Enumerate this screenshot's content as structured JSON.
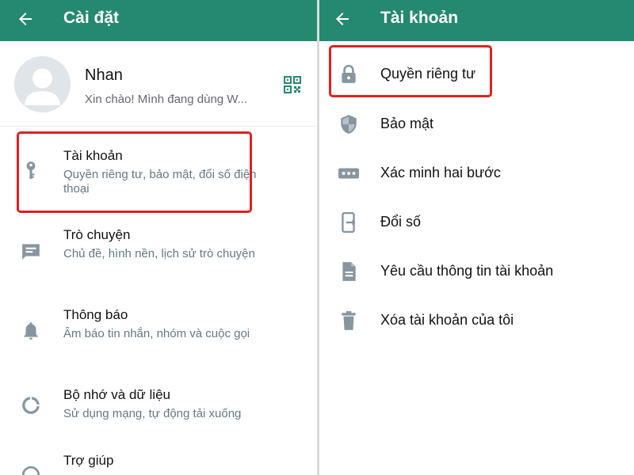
{
  "left": {
    "header_title": "Cài đặt",
    "profile": {
      "name": "Nhan",
      "status": "Xin chào! Mình đang dùng W..."
    },
    "items": [
      {
        "title": "Tài khoản",
        "subtitle": "Quyền riêng tư, bảo mật, đổi số điện thoại",
        "icon": "key-icon"
      },
      {
        "title": "Trò chuyện",
        "subtitle": "Chủ đề, hình nền, lịch sử trò chuyện",
        "icon": "chat-icon"
      },
      {
        "title": "Thông báo",
        "subtitle": "Âm báo tin nhắn, nhóm và cuộc gọi",
        "icon": "bell-icon"
      },
      {
        "title": "Bộ nhớ và dữ liệu",
        "subtitle": "Sử dụng mạng, tự động tải xuống",
        "icon": "data-usage-icon"
      },
      {
        "title": "Trợ giúp",
        "subtitle": "",
        "icon": "help-icon"
      }
    ]
  },
  "right": {
    "header_title": "Tài khoản",
    "items": [
      {
        "label": "Quyền riêng tư",
        "icon": "lock-icon"
      },
      {
        "label": "Bảo mật",
        "icon": "shield-icon"
      },
      {
        "label": "Xác minh hai bước",
        "icon": "dots-icon"
      },
      {
        "label": "Đổi số",
        "icon": "change-number-icon"
      },
      {
        "label": "Yêu cầu thông tin tài khoản",
        "icon": "document-icon"
      },
      {
        "label": "Xóa tài khoản của tôi",
        "icon": "trash-icon"
      }
    ]
  },
  "colors": {
    "header": "#24896f",
    "icon": "#8696a0",
    "highlight": "#e02020",
    "qr": "#24896f"
  }
}
